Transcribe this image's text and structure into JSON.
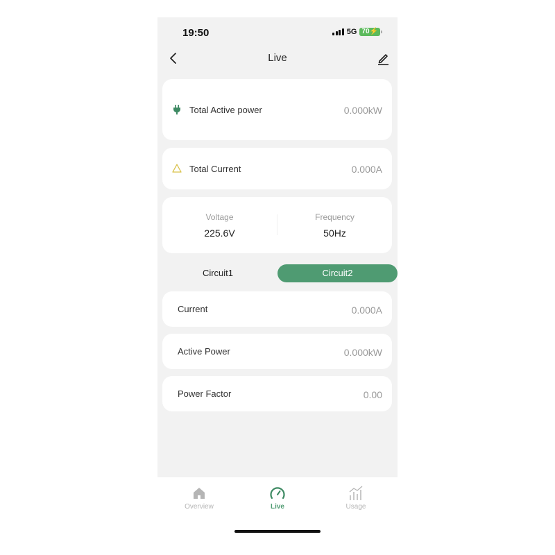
{
  "status_bar": {
    "time": "19:50",
    "network": "5G",
    "battery": "70"
  },
  "header": {
    "title": "Live",
    "back_icon": "chevron-left-icon",
    "edit_icon": "pencil-icon"
  },
  "totals": {
    "active_power": {
      "label": "Total Active power",
      "value": "0.000kW",
      "icon": "plug-icon",
      "icon_color": "#3e8a63"
    },
    "current": {
      "label": "Total Current",
      "value": "0.000A",
      "icon": "warning-triangle-icon",
      "icon_color": "#d9c24a"
    }
  },
  "grid": {
    "voltage": {
      "label": "Voltage",
      "value": "225.6V"
    },
    "frequency": {
      "label": "Frequency",
      "value": "50Hz"
    }
  },
  "circuit_tabs": [
    {
      "label": "Circuit1",
      "selected": false
    },
    {
      "label": "Circuit2",
      "selected": true
    }
  ],
  "circuit_metrics": [
    {
      "label": "Current",
      "value": "0.000A"
    },
    {
      "label": "Active Power",
      "value": "0.000kW"
    },
    {
      "label": "Power Factor",
      "value": "0.00"
    }
  ],
  "tab_bar": [
    {
      "label": "Overview",
      "icon": "home-icon",
      "active": false
    },
    {
      "label": "Live",
      "icon": "gauge-icon",
      "active": true
    },
    {
      "label": "Usage",
      "icon": "chart-icon",
      "active": false
    }
  ],
  "colors": {
    "accent": "#4f9b72",
    "inactive": "#b5b5b5",
    "background": "#f2f2f2"
  }
}
